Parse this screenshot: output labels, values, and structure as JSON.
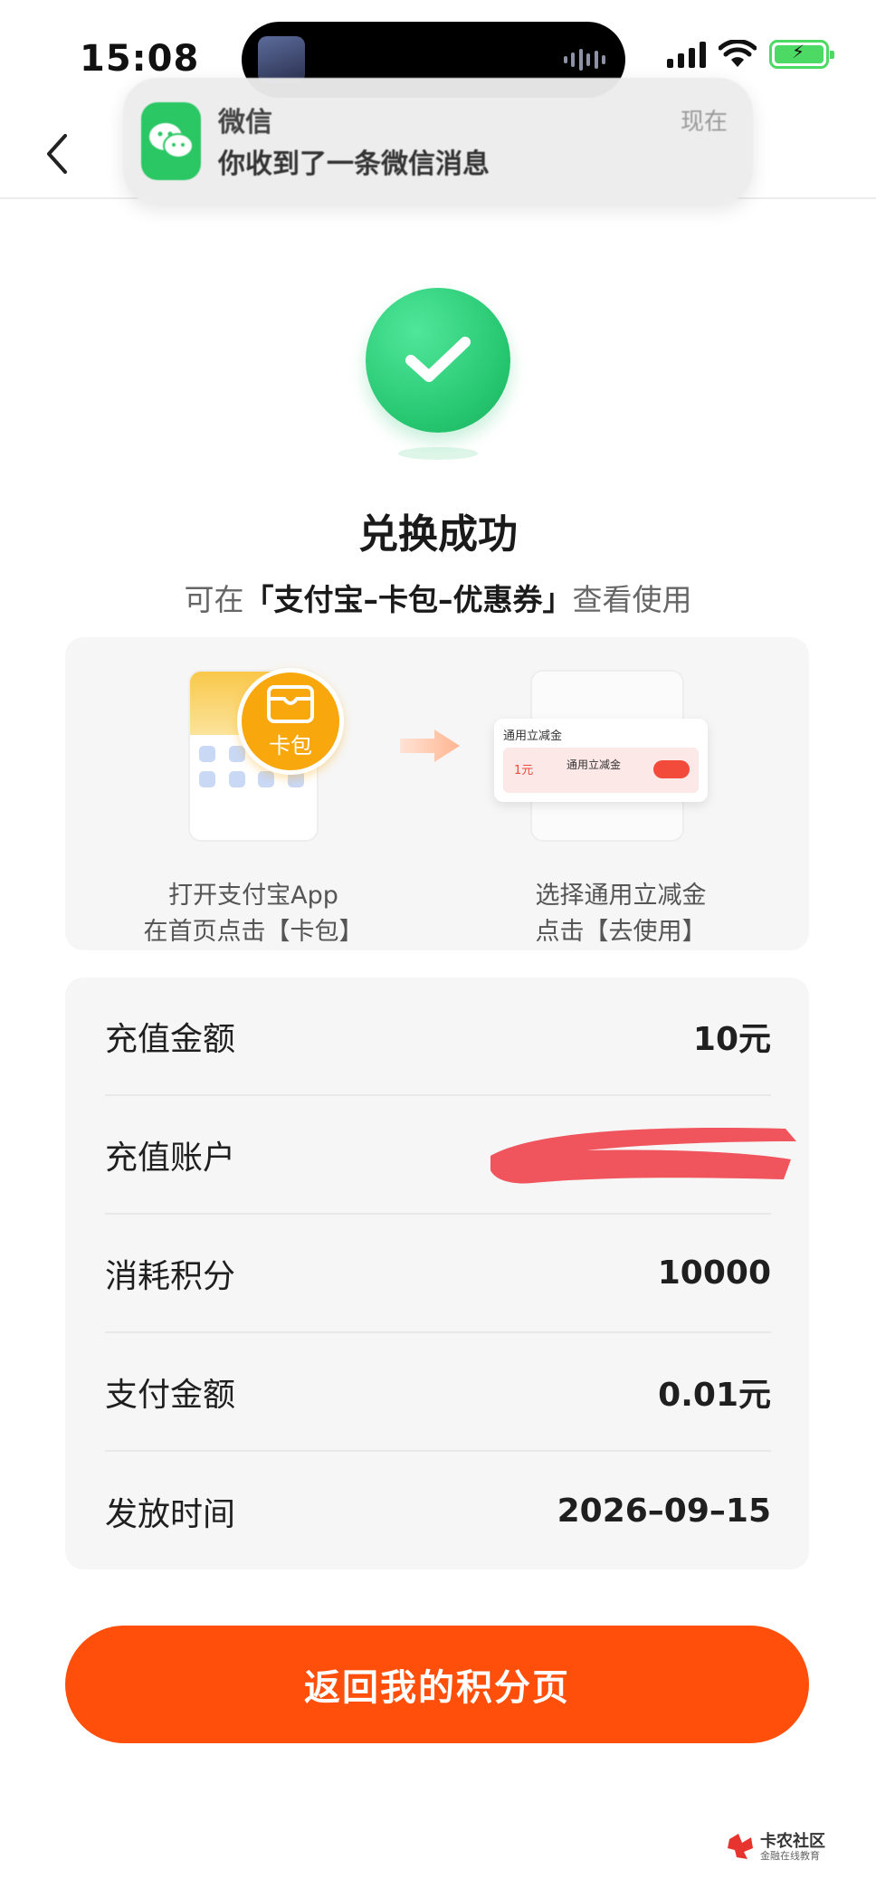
{
  "status_bar": {
    "time": "15:08",
    "battery_color": "#4cd964"
  },
  "notification": {
    "app_name": "微信",
    "message": "你收到了一条微信消息",
    "time": "现在",
    "icon": "wechat-icon"
  },
  "header": {
    "back_icon": "chevron-left-icon"
  },
  "success": {
    "title": "兑换成功",
    "subtitle_prefix": "可在",
    "subtitle_highlight": "「支付宝–卡包–优惠券」",
    "subtitle_suffix": "查看使用",
    "icon_color": "#24c46e"
  },
  "guide": {
    "badge_label": "卡包",
    "step1_line1": "打开支付宝App",
    "step1_line2": "在首页点击【卡包】",
    "step2_line1": "选择通用立减金",
    "step2_line2": "点击【去使用】",
    "coupon_header": "通用立减金",
    "coupon_amount": "1元",
    "coupon_name": "通用立减金"
  },
  "details": [
    {
      "label": "充值金额",
      "value": "10元"
    },
    {
      "label": "充值账户",
      "value": ""
    },
    {
      "label": "消耗积分",
      "value": "10000"
    },
    {
      "label": "支付金额",
      "value": "0.01元"
    },
    {
      "label": "发放时间",
      "value": "2026–09–15"
    }
  ],
  "actions": {
    "return_label": "返回我的积分页",
    "accent_color": "#ff4f0b"
  },
  "watermark": {
    "title": "卡农社区",
    "subtitle": "金融在线教育"
  }
}
